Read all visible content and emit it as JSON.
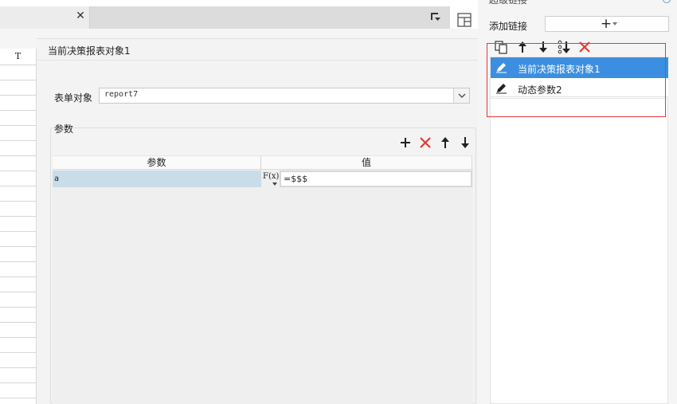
{
  "tabs": {
    "close_glyph": "✕"
  },
  "grid": {
    "column_header": "T"
  },
  "dialog": {
    "title": "当前决策报表对象1",
    "form_label": "表单对象",
    "form_value": "report7",
    "params_title": "参数",
    "table": {
      "headers": [
        "参数",
        "值"
      ],
      "rows": [
        {
          "name": "a",
          "fx": "F(x)",
          "value": "=$$$"
        }
      ]
    },
    "toolbar_icons": [
      "add-icon",
      "delete-icon",
      "move-up-icon",
      "move-down-icon"
    ]
  },
  "right_panel": {
    "header": "超级链接",
    "add_link_label": "添加链接",
    "add_link_glyph": "+",
    "toolbar_icons": [
      "copy-icon",
      "move-up-icon",
      "move-down-icon",
      "sort-icon",
      "delete-icon"
    ],
    "links": [
      {
        "label": "当前决策报表对象1",
        "selected": true
      },
      {
        "label": "动态参数2",
        "selected": false
      }
    ]
  },
  "colors": {
    "accent": "#3c8fe0",
    "delete": "#e53935",
    "highlight": "#e63737",
    "row_selected": "#c9dce9"
  }
}
